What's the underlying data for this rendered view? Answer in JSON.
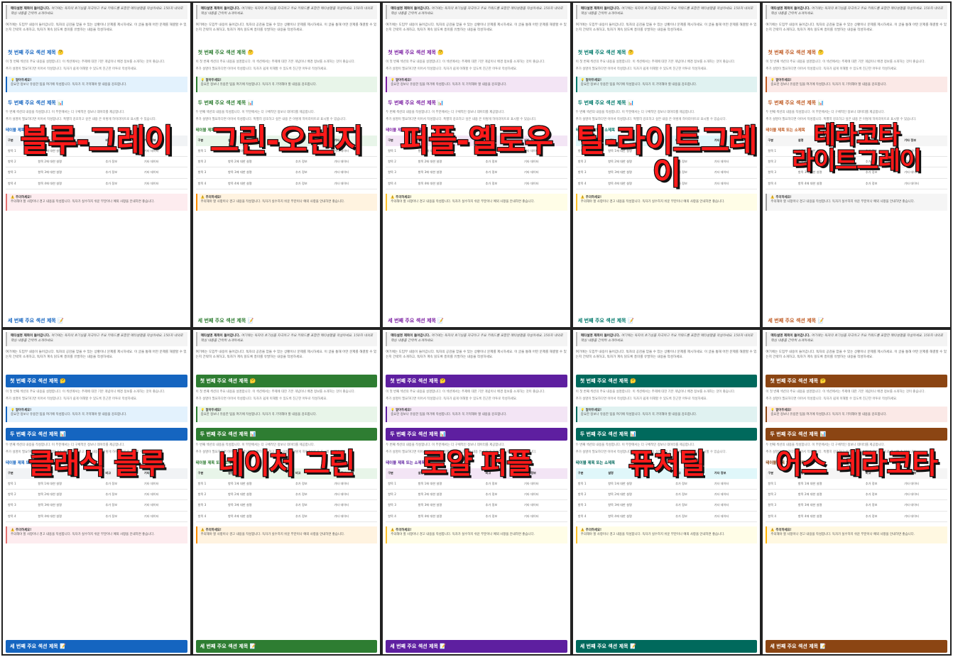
{
  "common": {
    "note_bold": "매타설명 제목이 들어갑니다.",
    "note_text": "여기에는 독자의 호기심을 자극하고 주요 키워드를 포함한 메타설명을 작성하세요. 150자 내외로 핵심 내용을 간략히 소개하세요.",
    "intro": "여기에는 도입부 내용이 들어갑니다. 독자의 공감을 얻을 수 있는 상황이나 문제를 제시하세요. 이 글을 통해 어떤 문제를 해결할 수 있는지 간략히 소개하고, 독자가 계속 읽도록 흥미를 유발하는 내용을 작성하세요.",
    "section1": "첫 번째 주요 섹션 제목 🤔",
    "s1_line1": "이 첫 번째 섹션의 주요 내용을 설명합니다. 이 섹션에서는 주제에 대한 기본 개념이나 배경 정보를 소개하는 것이 좋습니다.",
    "s1_line2": "추가 설명이 필요하다면 이어서 작성합니다. 독자가 쉽게 이해할 수 있도록 친근한 어투로 작성하세요.",
    "tip_title": "💡 알아두세요!",
    "tip_text": "중요한 정보나 유용한 팁을 여기에 작성합니다. 독자가 꼭 기억해야 할 내용을 강조합니다.",
    "section2": "두 번째 주요 섹션 제목 📊",
    "s2_line1": "두 번째 섹션의 내용을 작성합니다. 이 부분에서는 더 구체적인 정보나 데이터를 제공합니다.",
    "s2_line2": "추가 설명이 필요하다면 이어서 작성합니다. 특별히 강조하고 싶은 내용 은 이렇게 하이라이트로 표시할 수 있습니다.",
    "subheading": "테이블 제목 또는 소제목",
    "table_headers": [
      "구분",
      "설명",
      "비고",
      "기타 정보"
    ],
    "table_rows": [
      [
        "항목 1",
        "항목 1에 대한 설명",
        "추가 정보",
        "기타 데이터"
      ],
      [
        "항목 2",
        "항목 2에 대한 설명",
        "추가 정보",
        "기타 데이터"
      ],
      [
        "항목 3",
        "항목 3에 대한 설명",
        "추가 정보",
        "기타 데이터"
      ],
      [
        "항목 4",
        "항목 4에 대한 설명",
        "추가 정보",
        "기타 데이터"
      ]
    ],
    "warn_title": "⚠️ 주의하세요!",
    "warn_text": "주의해야 할 사항이나 경고 내용을 작성합니다. 독자가 실수하지 쉬운 부분이나 예외 사항을 안내하면 좋습니다.",
    "section3": "세 번째 주요 섹션 제목 📝"
  },
  "panels": [
    {
      "label": "블루-그레이",
      "accent": "#1565c0",
      "tip_bg": "#e3f2fd",
      "warn_bg": "#fdecef",
      "warn_border": "#e57373",
      "th_bg": "#f1f3f5",
      "filled": false,
      "label_lines": 1
    },
    {
      "label": "그린-오렌지",
      "accent": "#2e7d32",
      "tip_bg": "#e8f5e9",
      "warn_bg": "#fff3e0",
      "warn_border": "#fb8c00",
      "th_bg": "#e8f5e9",
      "filled": false,
      "label_lines": 1
    },
    {
      "label": "퍼플-옐로우",
      "accent": "#7b1fa2",
      "tip_bg": "#f3e5f5",
      "warn_bg": "#fffde7",
      "warn_border": "#fbc02d",
      "th_bg": "#f3e5f5",
      "filled": false,
      "label_lines": 1
    },
    {
      "label": "틸-라이트그레이",
      "accent": "#00796b",
      "tip_bg": "#e0f2f1",
      "warn_bg": "#fffde7",
      "warn_border": "#fbc02d",
      "th_bg": "#e0f7fa",
      "filled": false,
      "label_lines": 1
    },
    {
      "label": "테라코타 라이트그레이",
      "accent": "#bf5a22",
      "tip_bg": "#fbe9e7",
      "warn_bg": "#f5f5f5",
      "warn_border": "#9e9e9e",
      "th_bg": "#f5f5f5",
      "filled": false,
      "label_lines": 2
    },
    {
      "label": "클래식 블루",
      "accent": "#1565c0",
      "tip_bg": "#e3f2fd",
      "warn_bg": "#fdecef",
      "warn_border": "#e57373",
      "th_bg": "#f1f3f5",
      "filled": true,
      "label_lines": 1
    },
    {
      "label": "네이처 그린",
      "accent": "#2e7d32",
      "tip_bg": "#e8f5e9",
      "warn_bg": "#fff3e0",
      "warn_border": "#fb8c00",
      "th_bg": "#e8f5e9",
      "filled": true,
      "label_lines": 1
    },
    {
      "label": "로얄 퍼플",
      "accent": "#5e1fa0",
      "tip_bg": "#f3e5f5",
      "warn_bg": "#fffde7",
      "warn_border": "#fbc02d",
      "th_bg": "#f3e5f5",
      "filled": true,
      "label_lines": 1
    },
    {
      "label": "퓨처틸",
      "accent": "#00695c",
      "tip_bg": "#e0f2f1",
      "warn_bg": "#fffde7",
      "warn_border": "#fbc02d",
      "th_bg": "#e0f7fa",
      "filled": true,
      "label_lines": 1
    },
    {
      "label": "어스 테라코타",
      "accent": "#8b4513",
      "tip_bg": "#fbe9e7",
      "warn_bg": "#fff8e1",
      "warn_border": "#ffb300",
      "th_bg": "#f5f5f5",
      "filled": true,
      "label_lines": 1
    }
  ]
}
